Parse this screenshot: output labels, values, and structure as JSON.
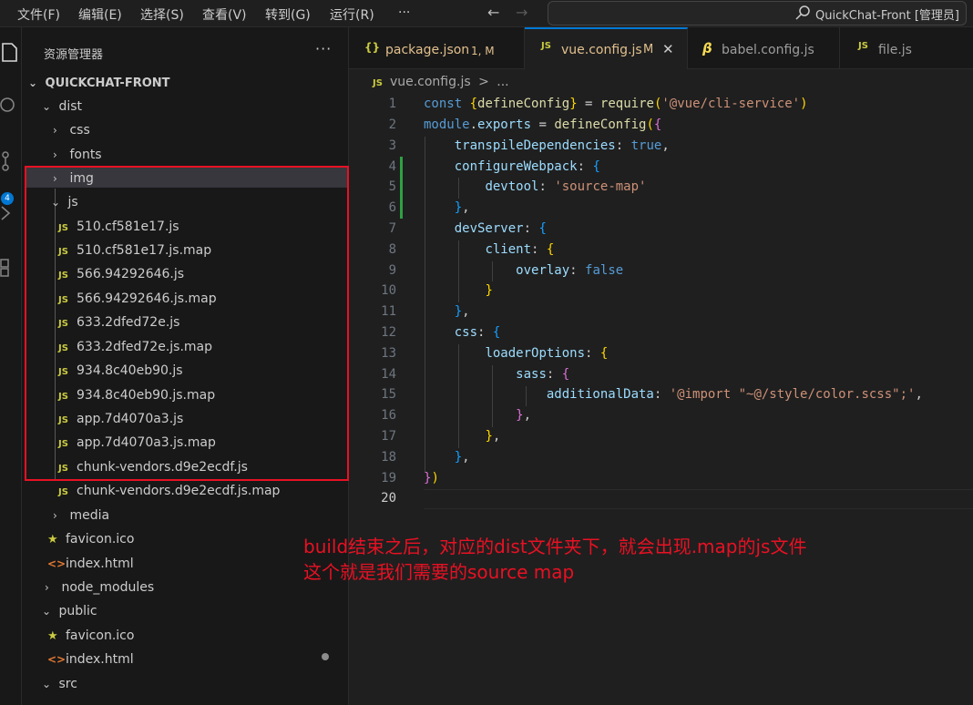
{
  "menu": {
    "items": [
      "文件(F)",
      "编辑(E)",
      "选择(S)",
      "查看(V)",
      "转到(G)",
      "运行(R)",
      "···"
    ]
  },
  "command_center": {
    "text": "QuickChat-Front [管理员]"
  },
  "activity_bar": {
    "scm_badge": "4"
  },
  "explorer": {
    "title": "资源管理器",
    "more": "···",
    "root": "QUICKCHAT-FRONT",
    "tree": [
      {
        "label": "dist",
        "kind": "folder-open"
      },
      {
        "label": "css",
        "kind": "folder"
      },
      {
        "label": "fonts",
        "kind": "folder"
      },
      {
        "label": "img",
        "kind": "folder"
      },
      {
        "label": "js",
        "kind": "folder-open"
      },
      {
        "label": "510.cf581e17.js",
        "kind": "js"
      },
      {
        "label": "510.cf581e17.js.map",
        "kind": "js"
      },
      {
        "label": "566.94292646.js",
        "kind": "js"
      },
      {
        "label": "566.94292646.js.map",
        "kind": "js"
      },
      {
        "label": "633.2dfed72e.js",
        "kind": "js"
      },
      {
        "label": "633.2dfed72e.js.map",
        "kind": "js"
      },
      {
        "label": "934.8c40eb90.js",
        "kind": "js"
      },
      {
        "label": "934.8c40eb90.js.map",
        "kind": "js"
      },
      {
        "label": "app.7d4070a3.js",
        "kind": "js"
      },
      {
        "label": "app.7d4070a3.js.map",
        "kind": "js"
      },
      {
        "label": "chunk-vendors.d9e2ecdf.js",
        "kind": "js"
      },
      {
        "label": "chunk-vendors.d9e2ecdf.js.map",
        "kind": "js"
      },
      {
        "label": "media",
        "kind": "folder"
      },
      {
        "label": "favicon.ico",
        "kind": "star"
      },
      {
        "label": "index.html",
        "kind": "html"
      },
      {
        "label": "node_modules",
        "kind": "folder"
      },
      {
        "label": "public",
        "kind": "folder-open"
      },
      {
        "label": "favicon.ico",
        "kind": "star"
      },
      {
        "label": "index.html",
        "kind": "html"
      },
      {
        "label": "src",
        "kind": "folder-open"
      }
    ]
  },
  "tabs": [
    {
      "icon": "{}",
      "label": "package.json",
      "status": "1, M"
    },
    {
      "icon": "JS",
      "label": "vue.config.js",
      "status": "M",
      "close": "✕"
    },
    {
      "icon": "β",
      "label": "babel.config.js",
      "status": ""
    },
    {
      "icon": "JS",
      "label": "file.js",
      "status": ""
    }
  ],
  "breadcrumb": {
    "icon": "JS",
    "file": "vue.config.js",
    "sep": ">",
    "rest": "..."
  },
  "editor": {
    "line_numbers": [
      "1",
      "2",
      "3",
      "4",
      "5",
      "6",
      "7",
      "8",
      "9",
      "10",
      "11",
      "12",
      "13",
      "14",
      "15",
      "16",
      "17",
      "18",
      "19",
      "20"
    ],
    "lines": [
      "const {defineConfig} = require('@vue/cli-service')",
      "module.exports = defineConfig({",
      "    transpileDependencies: true,",
      "    configureWebpack: {",
      "        devtool: 'source-map'",
      "    },",
      "    devServer: {",
      "        client: {",
      "            overlay: false",
      "        }",
      "    },",
      "    css: {",
      "        loaderOptions: {",
      "            sass: {",
      "                additionalData: '@import \"~@/style/color.scss\";',",
      "            },",
      "        },",
      "    },",
      "})",
      ""
    ],
    "colors": {
      "keyword": "#569cd6",
      "variable": "#9cdcfe",
      "function": "#dcdcaa",
      "string": "#ce9178",
      "bracket1": "#ffd700",
      "bracket2": "#da70d6",
      "bracket3": "#179fff"
    }
  },
  "annotation": {
    "line1": "build结束之后，对应的dist文件夹下，就会出现.map的js文件",
    "line2": "这个就是我们需要的source map",
    "color": "#e81123"
  }
}
